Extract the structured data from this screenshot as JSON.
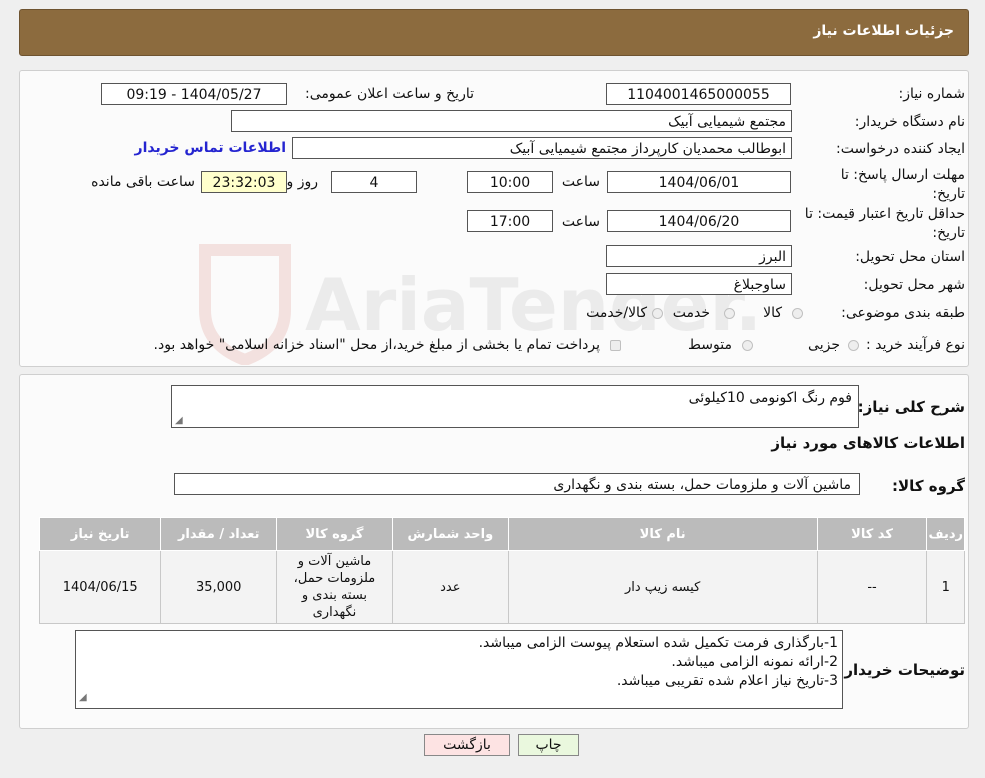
{
  "header": {
    "title": "جزئیات اطلاعات نیاز"
  },
  "form": {
    "need_number_label": "شماره نیاز:",
    "need_number": "1104001465000055",
    "announce_label": "تاریخ و ساعت اعلان عمومی:",
    "announce_value": "1404/05/27 - 09:19",
    "buyer_org_label": "نام دستگاه خریدار:",
    "buyer_org": "مجتمع شیمیایی آبیک",
    "creator_label": "ایجاد کننده درخواست:",
    "creator": "ابوطالب محمدیان کارپرداز مجتمع شیمیایی آبیک",
    "contact_link": "اطلاعات تماس خریدار",
    "deadline_label_1": "مهلت ارسال پاسخ: تا",
    "deadline_label_2": "تاریخ:",
    "deadline_date": "1404/06/01",
    "hour_label": "ساعت",
    "deadline_time": "10:00",
    "days_value": "4",
    "days_label": "روز و",
    "remaining_time": "23:32:03",
    "remaining_label": "ساعت باقی مانده",
    "validity_label_1": "حداقل تاریخ اعتبار قیمت: تا",
    "validity_label_2": "تاریخ:",
    "validity_date": "1404/06/20",
    "validity_time": "17:00",
    "province_label": "استان محل تحویل:",
    "province": "البرز",
    "city_label": "شهر محل تحویل:",
    "city": "ساوجبلاغ",
    "category_label": "طبقه بندی موضوعی:",
    "category_options": [
      "کالا",
      "خدمت",
      "کالا/خدمت"
    ],
    "process_label": "نوع فرآیند خرید :",
    "process_options": [
      "جزیی",
      "متوسط"
    ],
    "process_note": "پرداخت تمام یا بخشی از مبلغ خرید،از محل \"اسناد خزانه اسلامی\" خواهد بود."
  },
  "details": {
    "general_desc_label": "شرح کلی نیاز:",
    "general_desc": "فوم رنگ اکونومی 10کیلوئی",
    "goods_info_title": "اطلاعات کالاهای مورد نیاز",
    "goods_group_label": "گروه کالا:",
    "goods_group": "ماشین آلات و ملزومات حمل، بسته بندی و نگهداری",
    "table": {
      "headers": [
        "ردیف",
        "کد کالا",
        "نام کالا",
        "واحد شمارش",
        "گروه کالا",
        "تعداد / مقدار",
        "تاریخ نیاز"
      ],
      "rows": [
        [
          "1",
          "--",
          "کیسه زیپ دار",
          "عدد",
          "ماشین آلات و ملزومات حمل، بسته بندی و نگهداری",
          "35,000",
          "1404/06/15"
        ]
      ]
    },
    "buyer_notes_label": "توضیحات خریدار:",
    "buyer_notes": [
      "1-بارگذاری فرمت تکمیل شده استعلام پیوست الزامی میباشد.",
      "2-ارائه نمونه الزامی میباشد.",
      "3-تاریخ نیاز اعلام شده تقریبی میباشد."
    ]
  },
  "buttons": {
    "print": "چاپ",
    "back": "بازگشت"
  },
  "watermark": {
    "text": "AriaTender.neT"
  },
  "colors": {
    "header_bg": "#8c6b3e",
    "link": "#2424d0",
    "back_button_bg": "#fde3e3",
    "print_button_bg": "#eaf8de"
  }
}
